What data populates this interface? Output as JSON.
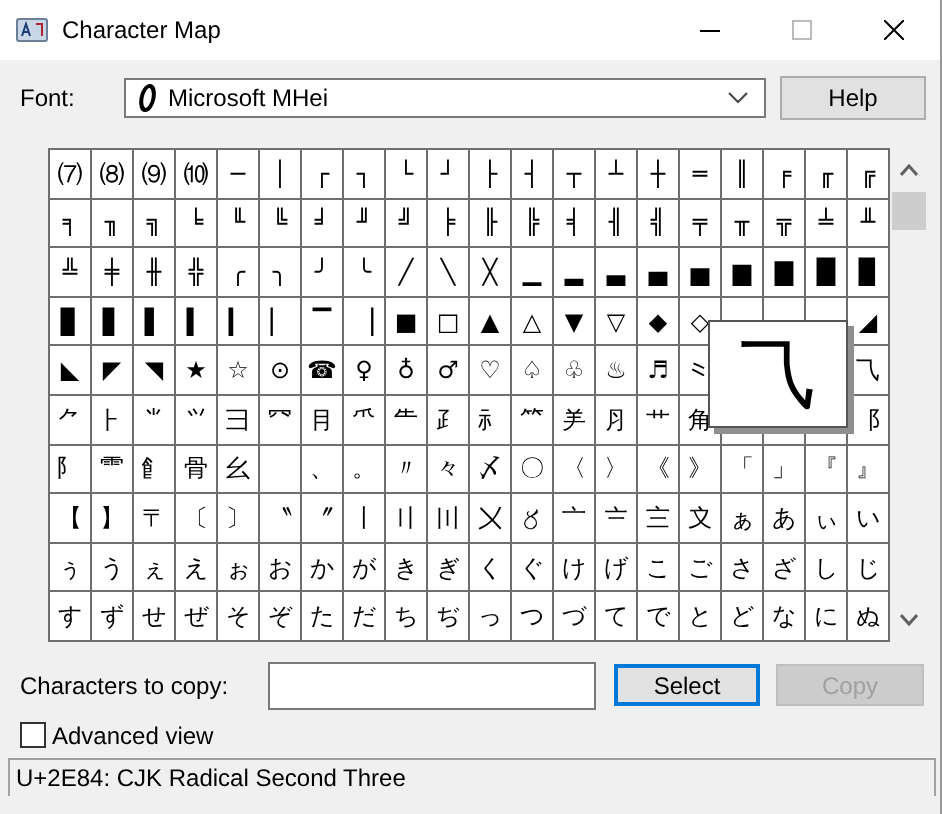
{
  "window": {
    "title": "Character Map"
  },
  "font": {
    "label": "Font:",
    "value": "Microsoft MHei"
  },
  "help_button": "Help",
  "grid": {
    "rows": [
      [
        "⑺",
        "⑻",
        "⑼",
        "⑽",
        "─",
        "│",
        "┌",
        "┐",
        "└",
        "┘",
        "├",
        "┤",
        "┬",
        "┴",
        "┼",
        "═",
        "║",
        "╒",
        "╓",
        "╔"
      ],
      [
        "╕",
        "╖",
        "╗",
        "╘",
        "╙",
        "╚",
        "╛",
        "╜",
        "╝",
        "╞",
        "╟",
        "╠",
        "╡",
        "╢",
        "╣",
        "╤",
        "╥",
        "╦",
        "╧",
        "╨"
      ],
      [
        "╩",
        "╪",
        "╫",
        "╬",
        "╭",
        "╮",
        "╯",
        "╰",
        "╱",
        "╲",
        "╳",
        "▁",
        "▂",
        "▃",
        "▄",
        "▅",
        "▆",
        "▇",
        "█",
        "▉"
      ],
      [
        "▊",
        "▋",
        "▌",
        "▍",
        "▎",
        "▏",
        "▔",
        "▕",
        "■",
        "□",
        "▲",
        "△",
        "▼",
        "▽",
        "◆",
        "◇",
        null,
        null,
        null,
        "◢"
      ],
      [
        "◣",
        "◤",
        "◥",
        "★",
        "☆",
        "⊙",
        "☎",
        "♀",
        "♁",
        "♂",
        "♡",
        "♤",
        "♧",
        "♨",
        "♬",
        "⺀",
        null,
        null,
        null,
        "⺄"
      ],
      [
        "⺈",
        "⺊",
        "⺌",
        "⺍",
        "⺕",
        "⺳",
        "⺝",
        "⺥",
        "⺧",
        "⺪",
        "⺬",
        "⺮",
        "⺶",
        "⺼",
        "⺾",
        "⻆",
        null,
        null,
        null,
        "⻏"
      ],
      [
        "⻖",
        "⻗",
        "⻞",
        "⻣",
        "⺓",
        "　",
        "、",
        "。",
        "〃",
        "々",
        "〆",
        "〇",
        "〈",
        "〉",
        "《",
        "》",
        "「",
        "」",
        "『",
        "』"
      ],
      [
        "【",
        "】",
        "〒",
        "〔",
        "〕",
        "〝",
        "〞",
        "〡",
        "〢",
        "〣",
        "〤",
        "〥",
        "〦",
        "〧",
        "〨",
        "〩",
        "ぁ",
        "あ",
        "ぃ",
        "い"
      ],
      [
        "ぅ",
        "う",
        "ぇ",
        "え",
        "ぉ",
        "お",
        "か",
        "が",
        "き",
        "ぎ",
        "く",
        "ぐ",
        "け",
        "げ",
        "こ",
        "ご",
        "さ",
        "ざ",
        "し",
        "じ"
      ],
      [
        "す",
        "ず",
        "せ",
        "ぜ",
        "そ",
        "ぞ",
        "た",
        "だ",
        "ち",
        "ぢ",
        "っ",
        "つ",
        "づ",
        "て",
        "で",
        "と",
        "ど",
        "な",
        "に",
        "ぬ"
      ]
    ]
  },
  "tooltip": {
    "char": "⺄"
  },
  "copy": {
    "label": "Characters to copy:",
    "select_button": {
      "label": "Select",
      "focused": true
    },
    "copy_button": {
      "label": "Copy",
      "disabled": true
    }
  },
  "advanced_view": {
    "label": "Advanced view",
    "checked": false
  },
  "status": "U+2E84: CJK Radical Second Three"
}
